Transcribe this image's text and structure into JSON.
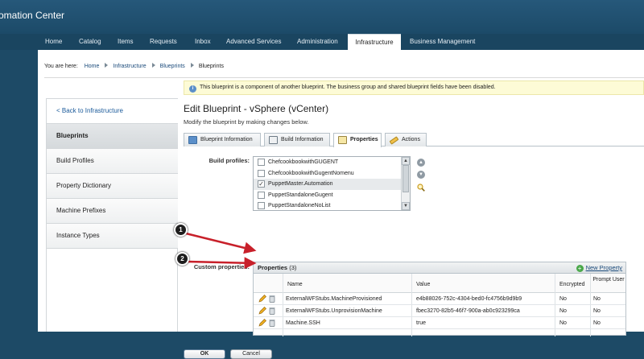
{
  "app": {
    "title": "omation Center"
  },
  "nav": [
    "Home",
    "Catalog",
    "Items",
    "Requests",
    "Inbox",
    "Advanced Services",
    "Administration",
    "Infrastructure",
    "Business Management"
  ],
  "breadcrumb": {
    "label": "You are here:",
    "items": [
      "Home",
      "Infrastructure",
      "Blueprints"
    ],
    "current": "Blueprints"
  },
  "info_banner": "This blueprint is a component of another blueprint. The business group and shared blueprint fields have been disabled.",
  "sidebar": {
    "back": "< Back to Infrastructure",
    "items": [
      "Blueprints",
      "Build Profiles",
      "Property Dictionary",
      "Machine Prefixes",
      "Instance Types"
    ],
    "selected": "Blueprints"
  },
  "page": {
    "title": "Edit Blueprint - vSphere (vCenter)",
    "subtitle": "Modify the blueprint by making changes below."
  },
  "tabs": [
    "Blueprint Information",
    "Build Information",
    "Properties",
    "Actions"
  ],
  "active_tab": "Properties",
  "build_profiles": {
    "label": "Build profiles:",
    "items": [
      {
        "name": "ChefcookbookwithGUGENT",
        "checked": false
      },
      {
        "name": "ChefcookbookwithGugentNomenu",
        "checked": false
      },
      {
        "name": "PuppetMaster.Automation",
        "checked": true
      },
      {
        "name": "PuppetStandaloneGugent",
        "checked": false
      },
      {
        "name": "PuppetStandaloneNoList",
        "checked": false
      }
    ]
  },
  "custom_properties": {
    "label": "Custom properties:",
    "title": "Properties",
    "count": "(3)",
    "new_label": "New Property",
    "columns": [
      "Name",
      "Value",
      "Encrypted",
      "Prompt User"
    ],
    "rows": [
      {
        "name": "ExternalWFStubs.MachineProvisioned",
        "value": "e4b88026-752c-4304-bed0-fc4756b9d9b9",
        "encrypted": "No",
        "prompt": "No"
      },
      {
        "name": "ExternalWFStubs.UnprovisionMachine",
        "value": "fbec3270-82b5-46f7-900a-ab0c923299ca",
        "encrypted": "No",
        "prompt": "No"
      },
      {
        "name": "Machine.SSH",
        "value": "true",
        "encrypted": "No",
        "prompt": "No"
      }
    ]
  },
  "buttons": {
    "ok": "OK",
    "cancel": "Cancel"
  },
  "callouts": [
    "1",
    "2"
  ],
  "colors": {
    "header": "#1d4a66",
    "callout_arrow": "#c8202a",
    "info_bg": "#fdfbd6",
    "new_prop_icon": "#4aa84a"
  }
}
